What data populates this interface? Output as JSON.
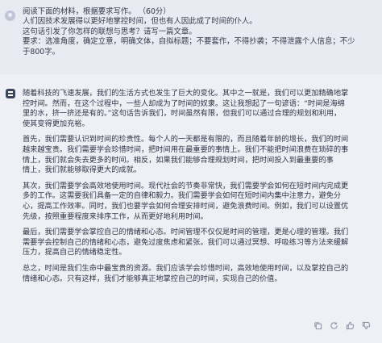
{
  "user_message": {
    "lines": [
      "阅读下面的材料，根据要求写作。  （60分）",
      "人们因技术发展得以更好地掌控时间，但也有人因此成了时间的仆人。",
      "这句话引发了你怎样的联想与思考？请写一篇文章。",
      "要求：选准角度，确定立意，明确文体，自拟标题；不要套作，不得抄袭；不得泄露个人信息；不少",
      "于800字。"
    ]
  },
  "ai_response": {
    "paragraphs": [
      [
        "随着科技的飞速发展，我们的生活方式也发生了巨大的变化。其中之一就是，我们可以更加精确地掌",
        "控时间。然而，在这个过程中，一些人却成为了时间的奴隶。这让我想起了一句谚语：“时间是海绵",
        "里的水，挤一挤还是有的。”这句话告诉我们，时间虽然有限，但我们可以通过合理的规划和利用，",
        "使其变得更加充裕。"
      ],
      [
        "首先，我们需要认识到时间的珍贵性。每个人的一天都是有限的，而且随着年龄的增长，我们的时间",
        "越来越宝贵。我们需要学会珍惜时间，把时间用在最重要的事情上。我们不能把时间浪费在琐碎的事",
        "情上，我们就会失去更多的时间。相反，如果我们能够合理规划时间，把时间投入到最重要的事",
        "情上，我们就能够取得更大的成就。"
      ],
      [
        "其次，我们需要学会高效地使用时间。现代社会的节奏非常快，我们需要学会如何在短时间内完成更",
        "多的工作。这需要我们具备一定的自律和毅力。我们需要学会如何在短时间内集中注意力，避免分",
        "心，提高工作效率。同时，我们也要学会如何合理安排时间，避免浪费时间。例如，我们可以设置优",
        "先级，按照重要程度来排序工作，从而更好地利用时间。"
      ],
      [
        "最后，我们需要学会掌控自己的情绪和心态。时间管理不仅仅是时间的管理，更是心理的管理。我们",
        "需要学会控制自己的情绪和心态，避免过度焦虑和紧张。我们可以通过冥想、呼吸练习等方法来缓解",
        "压力，提高自己的情绪稳定性。"
      ],
      [
        "总之，时间是我们生命中最宝贵的资源。我们应该学会珍惜时间，高效地使用时间，以及掌控自己的",
        "情绪和心态。只有这样，我们才能够真正地掌控自己的时间，实现自己的价值。"
      ]
    ]
  },
  "toolbar": {
    "icons": [
      "copy-icon",
      "refresh-icon",
      "thumbs-up-icon",
      "thumbs-down-icon"
    ]
  }
}
